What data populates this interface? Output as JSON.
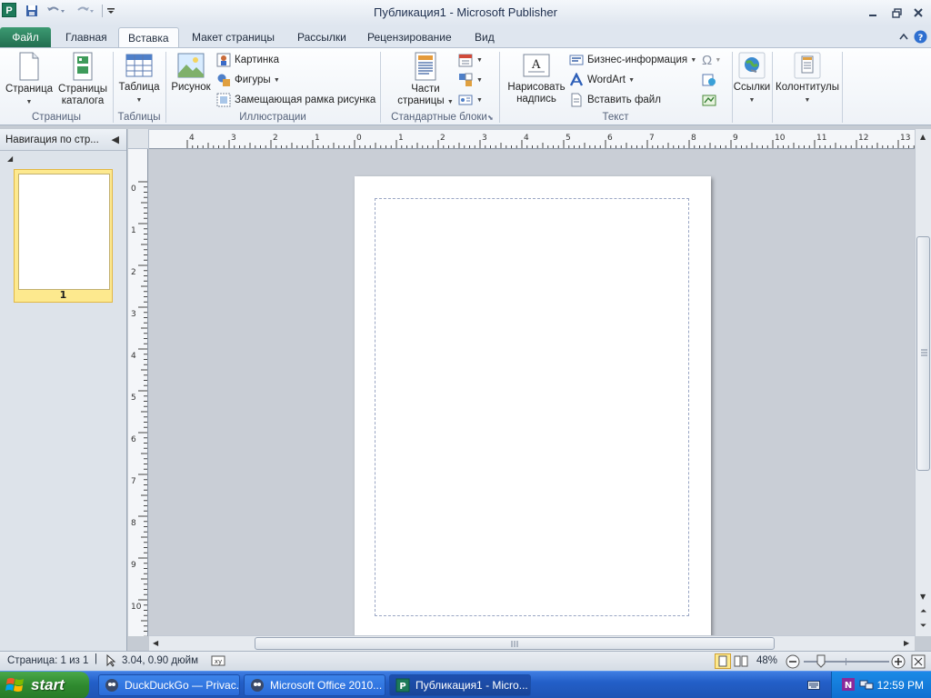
{
  "window": {
    "title": "Публикация1  -  Microsoft Publisher",
    "app_icon_letter": "P"
  },
  "tabs": {
    "file": "Файл",
    "home": "Главная",
    "insert": "Вставка",
    "page_design": "Макет страницы",
    "mailings": "Рассылки",
    "review": "Рецензирование",
    "view": "Вид"
  },
  "ribbon": {
    "pages": {
      "page": "Страница",
      "catalog1": "Страницы",
      "catalog2": "каталога",
      "group": "Страницы"
    },
    "tables": {
      "table": "Таблица",
      "group": "Таблицы"
    },
    "illustrations": {
      "picture": "Рисунок",
      "clipart": "Картинка",
      "shapes": "Фигуры",
      "placeholder": "Замещающая рамка рисунка",
      "group": "Иллюстрации"
    },
    "building_blocks": {
      "parts1": "Части",
      "parts2": "страницы",
      "group": "Стандартные блоки"
    },
    "text": {
      "draw1": "Нарисовать",
      "draw2": "надпись",
      "business": "Бизнес-информация",
      "wordart": "WordArt",
      "insert_file": "Вставить файл",
      "group": "Текст"
    },
    "links": {
      "label": "Ссылки"
    },
    "header_footer": {
      "label": "Колонтитулы"
    }
  },
  "nav": {
    "title": "Навигация по стр...",
    "page_number": "1"
  },
  "rulers": {
    "h_labels": [
      "4",
      "3",
      "2",
      "1",
      "0",
      "1",
      "2",
      "3",
      "4",
      "5",
      "6",
      "7",
      "8",
      "9",
      "10",
      "11",
      "12",
      "13"
    ],
    "v_labels": [
      "0",
      "1",
      "2",
      "3",
      "4",
      "5",
      "6",
      "7",
      "8",
      "9",
      "10"
    ]
  },
  "status": {
    "page": "Страница: 1 из 1",
    "position": "3.04, 0.90 дюйм",
    "zoom": "48%"
  },
  "taskbar": {
    "start": "start",
    "tasks": [
      "DuckDuckGo — Privac...",
      "Microsoft Office 2010...",
      "Публикация1 - Micro..."
    ],
    "clock": "12:59 PM"
  },
  "colors": {
    "accent": "#2a7a5a",
    "taskbar": "#235fc8",
    "start": "#2f8a2f"
  }
}
